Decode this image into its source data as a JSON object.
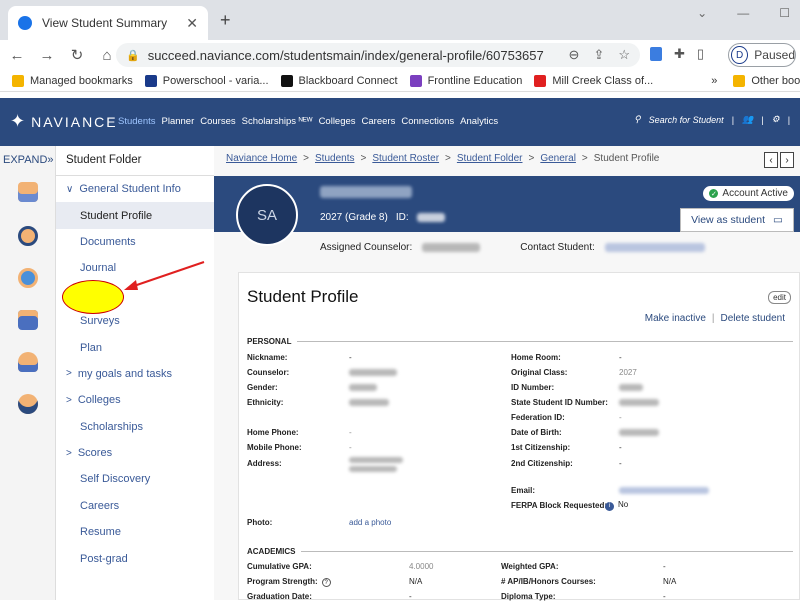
{
  "browser": {
    "tab_title": "View Student Summary",
    "url": "succeed.naviance.com/studentsmain/index/general-profile/60753657",
    "profile_initial": "D",
    "profile_label": "Paused",
    "bookmarks": [
      {
        "label": "Managed bookmarks",
        "color": "#f4b400"
      },
      {
        "label": "Powerschool - varia...",
        "color": "#1a3a8a"
      },
      {
        "label": "Blackboard Connect",
        "color": "#111111"
      },
      {
        "label": "Frontline Education",
        "color": "#7b3fbf"
      },
      {
        "label": "Mill Creek Class of...",
        "color": "#e02020"
      }
    ],
    "bookmarks_more": "»",
    "other_bookmarks": "Other bookma"
  },
  "header": {
    "logo": "NAVIANCE",
    "nav": [
      "Students",
      "Planner",
      "Courses",
      "Scholarships ᴺᴱᵂ",
      "Colleges",
      "Careers",
      "Connections",
      "Analytics"
    ],
    "search_label": "Search for Student",
    "brand_color": "#2b4a7e"
  },
  "rail": {
    "expand_label": "EXPAND",
    "icons": [
      "folder-person-icon",
      "search-person-icon",
      "support-icon",
      "list-person-icon",
      "group-person-icon",
      "transfer-person-icon"
    ]
  },
  "folder": {
    "title": "Student Folder",
    "items": [
      {
        "label": "General Student Info",
        "expandable": true,
        "chev": "∨"
      },
      {
        "label": "Student Profile",
        "active": true
      },
      {
        "label": "Documents"
      },
      {
        "label": "Journal"
      },
      {
        "label": ""
      },
      {
        "label": "Surveys"
      },
      {
        "label": "Plan"
      },
      {
        "label": "my goals and tasks",
        "expandable": true,
        "chev": ">"
      },
      {
        "label": "Colleges",
        "expandable": true,
        "chev": ">"
      },
      {
        "label": "Scholarships"
      },
      {
        "label": "Scores",
        "expandable": true,
        "chev": ">"
      },
      {
        "label": "Self Discovery"
      },
      {
        "label": "Careers"
      },
      {
        "label": "Resume"
      },
      {
        "label": "Post-grad"
      }
    ]
  },
  "breadcrumb": {
    "items": [
      "Naviance Home",
      "Students",
      "Student Roster",
      "Student Folder",
      "General"
    ],
    "current": "Student Profile",
    "separator": ">"
  },
  "student": {
    "initials": "SA",
    "grade_line": "2027 (Grade 8)",
    "id_label": "ID:",
    "account_status": "Account Active",
    "view_as_label": "View as student",
    "counselor_label": "Assigned Counselor:",
    "contact_label": "Contact Student:"
  },
  "profile": {
    "title": "Student Profile",
    "edit_label": "edit",
    "make_inactive": "Make inactive",
    "delete_student": "Delete student",
    "personal_heading": "PERSONAL",
    "left_fields": [
      {
        "label": "Nickname:",
        "value": "-"
      },
      {
        "label": "Counselor:",
        "value": ""
      },
      {
        "label": "Gender:",
        "value": ""
      },
      {
        "label": "Ethnicity:",
        "value": ""
      },
      {
        "label": "Home Phone:",
        "value": "-"
      },
      {
        "label": "Mobile Phone:",
        "value": "-"
      },
      {
        "label": "Address:",
        "value": ""
      }
    ],
    "right_fields": [
      {
        "label": "Home Room:",
        "value": "-"
      },
      {
        "label": "Original Class:",
        "value": "2027"
      },
      {
        "label": "ID Number:",
        "value": ""
      },
      {
        "label": "State Student ID Number:",
        "value": ""
      },
      {
        "label": "Federation ID:",
        "value": "-"
      },
      {
        "label": "Date of Birth:",
        "value": ""
      },
      {
        "label": "1st Citizenship:",
        "value": "-"
      },
      {
        "label": "2nd Citizenship:",
        "value": "-"
      },
      {
        "label": "Email:",
        "value": ""
      },
      {
        "label": "FERPA Block Requested:",
        "value": "No"
      }
    ],
    "photo_label": "Photo:",
    "photo_link": "add a photo",
    "academics_heading": "ACADEMICS",
    "academics": [
      {
        "label": "Cumulative GPA:",
        "value": "4.0000"
      },
      {
        "label": "Weighted GPA:",
        "value": "-"
      },
      {
        "label": "Program Strength:",
        "value": "N/A"
      },
      {
        "label": "# AP/IB/Honors Courses:",
        "value": "N/A"
      },
      {
        "label": "Graduation Date:",
        "value": "-"
      },
      {
        "label": "Diploma Type:",
        "value": "-"
      }
    ]
  }
}
